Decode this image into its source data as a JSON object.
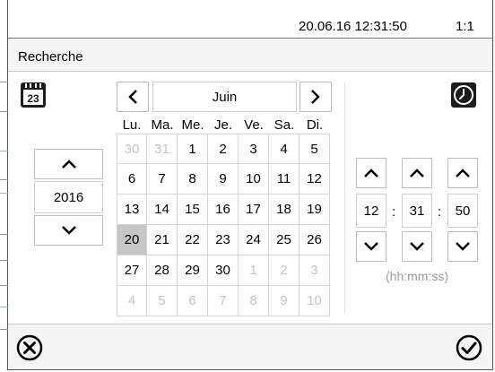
{
  "status": {
    "datetime": "20.06.16 12:31:50",
    "ratio": "1:1"
  },
  "dialog": {
    "title": "Recherche"
  },
  "calendar_icon": {
    "number": "23"
  },
  "year": {
    "value": "2016"
  },
  "calendar": {
    "month": "Juin",
    "weekdays": [
      "Lu.",
      "Ma.",
      "Me.",
      "Je.",
      "Ve.",
      "Sa.",
      "Di."
    ],
    "weeks": [
      [
        "30",
        "31",
        "1",
        "2",
        "3",
        "4",
        "5"
      ],
      [
        "6",
        "7",
        "8",
        "9",
        "10",
        "11",
        "12"
      ],
      [
        "13",
        "14",
        "15",
        "16",
        "17",
        "18",
        "19"
      ],
      [
        "20",
        "21",
        "22",
        "23",
        "24",
        "25",
        "26"
      ],
      [
        "27",
        "28",
        "29",
        "30",
        "1",
        "2",
        "3"
      ],
      [
        "4",
        "5",
        "6",
        "7",
        "8",
        "9",
        "10"
      ]
    ],
    "selected_day": "20"
  },
  "time": {
    "hours": "12",
    "minutes": "31",
    "seconds": "50",
    "separator": ":",
    "format_hint": "(hh:mm:ss)"
  },
  "icons": {
    "prev": "chevron-left-icon",
    "next": "chevron-right-icon",
    "up": "chevron-up-icon",
    "down": "chevron-down-icon",
    "cancel": "cancel-circle-icon",
    "confirm": "checkmark-circle-icon",
    "calendar": "calendar-icon",
    "clock": "clock-icon"
  }
}
